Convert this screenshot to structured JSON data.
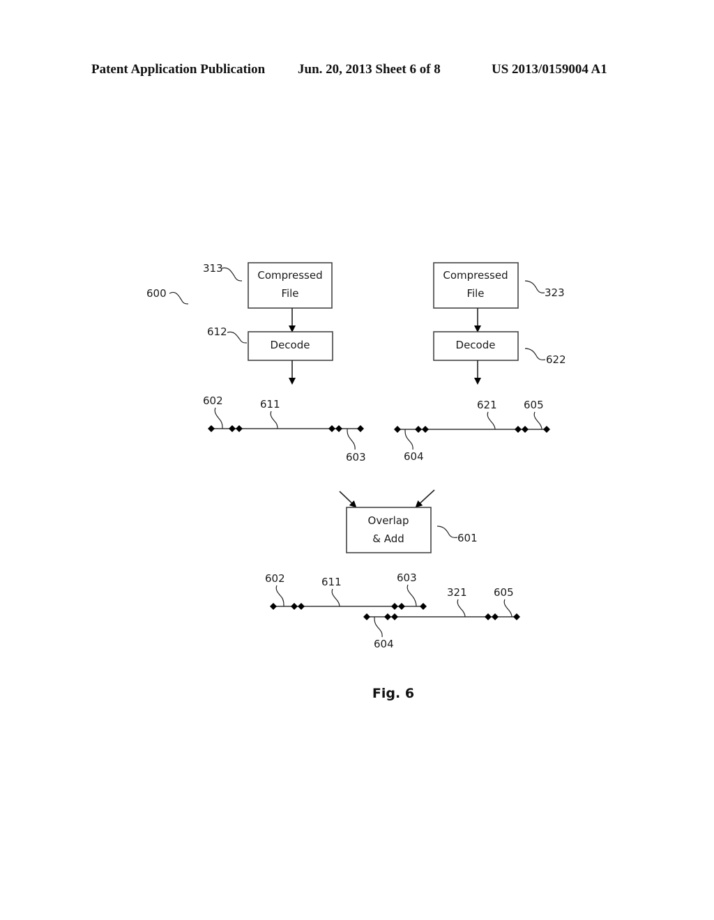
{
  "header": {
    "left": "Patent Application Publication",
    "middle": "Jun. 20, 2013   Sheet 6 of 8",
    "right": "US 2013/0159004 A1"
  },
  "figure": {
    "caption": "Fig. 6",
    "system_ref": "600",
    "blocks": {
      "compressed_file_1": {
        "line1": "Compressed",
        "line2": "File",
        "ref": "313"
      },
      "decode_1": {
        "label": "Decode",
        "ref": "612"
      },
      "compressed_file_2": {
        "line1": "Compressed",
        "line2": "File",
        "ref": "323"
      },
      "decode_2": {
        "label": "Decode",
        "ref": "622"
      },
      "overlap_add": {
        "line1": "Overlap",
        "line2": "& Add",
        "ref": "601"
      }
    },
    "timelines": {
      "decoded_1": {
        "refs": {
          "start": "602",
          "body": "611",
          "end": "603"
        }
      },
      "decoded_2": {
        "refs": {
          "start": "604",
          "body": "621",
          "end": "605"
        }
      },
      "combined": {
        "refs": {
          "start_1": "602",
          "body_1": "611",
          "end_1": "603",
          "body_2": "321",
          "end_2": "605",
          "start_2": "604"
        }
      }
    }
  }
}
